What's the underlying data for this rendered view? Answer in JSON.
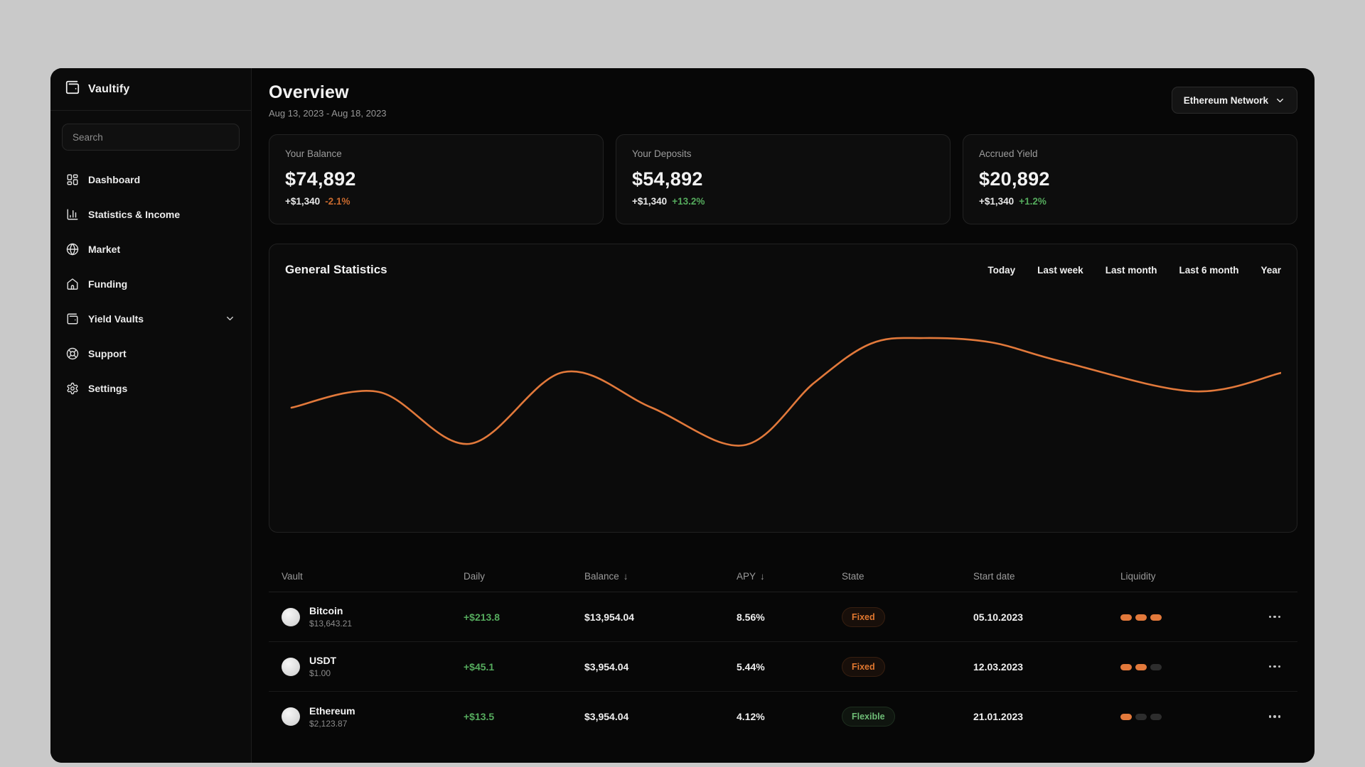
{
  "colors": {
    "page_background": "#c9c9c9",
    "app_background": "#070707",
    "accent_orange": "#e2793b",
    "positive_green": "#55ab5d",
    "negative_orange": "#c96a2e"
  },
  "sidebar": {
    "logo": "Vaultify",
    "search_placeholder": "Search",
    "items": [
      {
        "label": "Dashboard",
        "icon": "dashboard-icon"
      },
      {
        "label": "Statistics & Income",
        "icon": "chart-column-icon"
      },
      {
        "label": "Market",
        "icon": "globe-icon"
      },
      {
        "label": "Funding",
        "icon": "home-icon"
      },
      {
        "label": "Yield Vaults",
        "icon": "wallet-icon",
        "has_chevron": true
      },
      {
        "label": "Support",
        "icon": "lifebuoy-icon"
      },
      {
        "label": "Settings",
        "icon": "gear-icon"
      }
    ]
  },
  "header": {
    "title": "Overview",
    "date_range": "Aug 13, 2023 - Aug 18, 2023",
    "network_selector": "Ethereum Network"
  },
  "stat_cards": [
    {
      "label": "Your Balance",
      "value": "$74,892",
      "change_amount": "+$1,340",
      "change_pct": "-2.1%",
      "trend": "down"
    },
    {
      "label": "Your Deposits",
      "value": "$54,892",
      "change_amount": "+$1,340",
      "change_pct": "+13.2%",
      "trend": "up"
    },
    {
      "label": "Accrued Yield",
      "value": "$20,892",
      "change_amount": "+$1,340",
      "change_pct": "+1.2%",
      "trend": "up"
    }
  ],
  "chart_panel": {
    "title": "General Statistics",
    "filters": [
      "Today",
      "Last week",
      "Last month",
      "Last 6 month",
      "Year"
    ]
  },
  "chart_data": {
    "type": "line",
    "title": "General Statistics",
    "grid": false,
    "legend": false,
    "x_axis": {
      "visible": false
    },
    "y_axis": {
      "visible": false
    },
    "note": "No axis labels shown; points are relative pixel-space coordinates (y inverted, lower y = higher value)",
    "series": [
      {
        "name": "general-statistics-line",
        "color": "#e2793b",
        "points": [
          [
            10,
            125
          ],
          [
            134,
            103
          ],
          [
            262,
            176
          ],
          [
            395,
            75
          ],
          [
            520,
            125
          ],
          [
            650,
            178
          ],
          [
            750,
            90
          ],
          [
            830,
            35
          ],
          [
            905,
            27
          ],
          [
            1000,
            33
          ],
          [
            1100,
            60
          ],
          [
            1286,
            102
          ],
          [
            1411,
            76
          ]
        ]
      }
    ]
  },
  "table": {
    "columns": [
      {
        "label": "Vault"
      },
      {
        "label": "Daily"
      },
      {
        "label": "Balance",
        "sort_arrow": "↓"
      },
      {
        "label": "APY",
        "sort_arrow": "↓"
      },
      {
        "label": "State"
      },
      {
        "label": "Start date"
      },
      {
        "label": "Liquidity"
      }
    ],
    "rows": [
      {
        "name": "Bitcoin",
        "price": "$13,643.21",
        "daily": "+$213.8",
        "balance": "$13,954.04",
        "apy": "8.56%",
        "state": "Fixed",
        "state_color": "orange",
        "start_date": "05.10.2023",
        "liquidity": 3
      },
      {
        "name": "USDT",
        "price": "$1.00",
        "daily": "+$45.1",
        "balance": "$3,954.04",
        "apy": "5.44%",
        "state": "Fixed",
        "state_color": "orange",
        "start_date": "12.03.2023",
        "liquidity": 2
      },
      {
        "name": "Ethereum",
        "price": "$2,123.87",
        "daily": "+$13.5",
        "balance": "$3,954.04",
        "apy": "4.12%",
        "state": "Flexible",
        "state_color": "green",
        "start_date": "21.01.2023",
        "liquidity": 1
      }
    ]
  }
}
